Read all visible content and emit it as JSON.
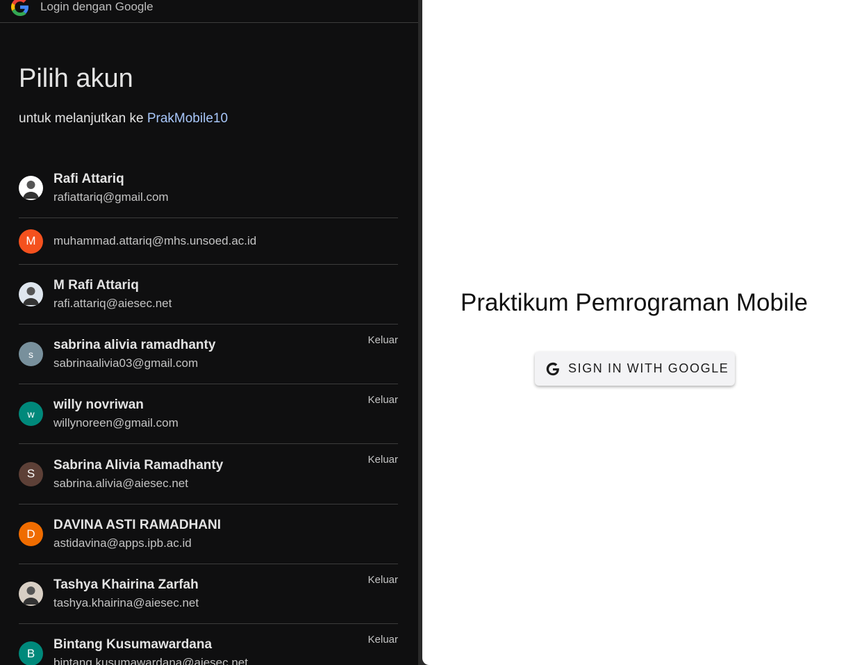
{
  "popup": {
    "header_title": "Login dengan Google",
    "heading": "Pilih akun",
    "subheading_prefix": "untuk melanjutkan ke",
    "app_name": "PrakMobile10",
    "signout_label": "Keluar",
    "accounts": [
      {
        "name": "Rafi Attariq",
        "email": "rafiattariq@gmail.com",
        "avatar": "photo",
        "avatar_letter": "",
        "avatar_color": "#ffffff"
      },
      {
        "name": "",
        "email": "muhammad.attariq@mhs.unsoed.ac.id",
        "avatar": "letter",
        "avatar_letter": "M",
        "avatar_color": "#f4511e"
      },
      {
        "name": "M Rafi Attariq",
        "email": "rafi.attariq@aiesec.net",
        "avatar": "photo",
        "avatar_letter": "",
        "avatar_color": "#dfe6ee"
      },
      {
        "name": "sabrina alivia ramadhanty",
        "email": "sabrinaalivia03@gmail.com",
        "avatar": "letter",
        "avatar_letter": "s",
        "avatar_color": "#78909c",
        "signed_in": true
      },
      {
        "name": "willy novriwan",
        "email": "willynoreen@gmail.com",
        "avatar": "letter",
        "avatar_letter": "w",
        "avatar_color": "#00897b",
        "signed_in": true
      },
      {
        "name": "Sabrina Alivia Ramadhanty",
        "email": "sabrina.alivia@aiesec.net",
        "avatar": "letter",
        "avatar_letter": "S",
        "avatar_color": "#5d4037",
        "signed_in": true
      },
      {
        "name": "DAVINA ASTI RAMADHANI",
        "email": "astidavina@apps.ipb.ac.id",
        "avatar": "letter",
        "avatar_letter": "D",
        "avatar_color": "#ef6c00"
      },
      {
        "name": "Tashya Khairina Zarfah",
        "email": "tashya.khairina@aiesec.net",
        "avatar": "photo",
        "avatar_letter": "",
        "avatar_color": "#d8cfc4",
        "signed_in": true
      },
      {
        "name": "Bintang Kusumawardana",
        "email": "bintang.kusumawardana@aiesec.net",
        "avatar": "letter",
        "avatar_letter": "B",
        "avatar_color": "#00897b",
        "signed_in": true
      }
    ]
  },
  "app": {
    "title": "Praktikum Pemrograman Mobile",
    "signin_label": "SIGN IN WITH GOOGLE"
  },
  "colors": {
    "popup_bg": "#0f0f10",
    "link": "#a8c7fa",
    "app_bg": "#ffffff"
  }
}
